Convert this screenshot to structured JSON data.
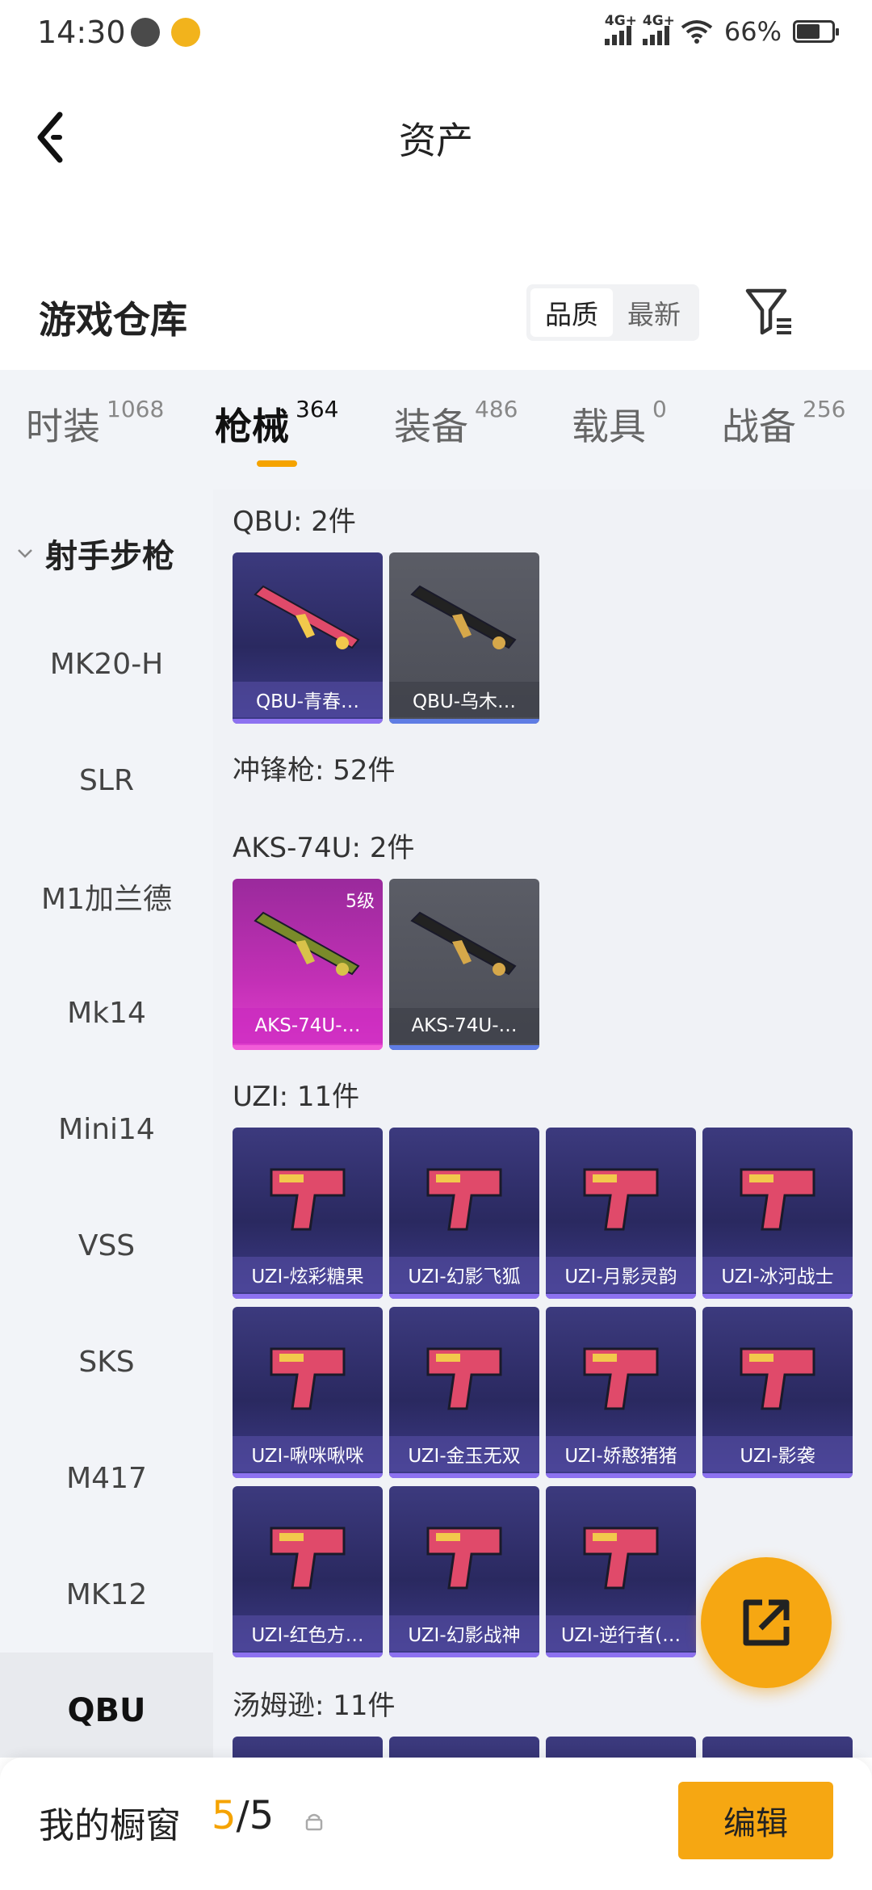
{
  "status_bar": {
    "time": "14:30",
    "network_1": "4G+",
    "network_2": "4G+",
    "battery": "66%",
    "battery_level": 0.66
  },
  "header": {
    "title": "资产",
    "back_icon": "chevron-left-icon"
  },
  "warehouse": {
    "title": "游戏仓库",
    "sort_options": [
      "品质",
      "最新"
    ],
    "sort_selected": "品质",
    "filter_icon": "filter-icon"
  },
  "tabs": [
    {
      "label": "时装",
      "count": "1068"
    },
    {
      "label": "枪械",
      "count": "364",
      "active": true
    },
    {
      "label": "装备",
      "count": "486"
    },
    {
      "label": "载具",
      "count": "0"
    },
    {
      "label": "战备",
      "count": "256"
    }
  ],
  "sidebar": {
    "group_label": "射手步枪",
    "items": [
      "MK20-H",
      "SLR",
      "M1加兰德",
      "Mk14",
      "Mini14",
      "VSS",
      "SKS",
      "M417",
      "MK12",
      "QBU"
    ],
    "active": "QBU"
  },
  "sections": {
    "qbu": "QBU: 2件",
    "smg": "冲锋枪: 52件",
    "aks": "AKS-74U: 2件",
    "uzi": "UZI: 11件",
    "thompson": "汤姆逊: 11件"
  },
  "cards": {
    "qbu": [
      {
        "name": "QBU-青春…",
        "rarity": "purple"
      },
      {
        "name": "QBU-乌木…",
        "rarity": "grey"
      }
    ],
    "aks": [
      {
        "name": "AKS-74U-…",
        "rarity": "pink",
        "level": "5级"
      },
      {
        "name": "AKS-74U-…",
        "rarity": "grey"
      }
    ],
    "uzi": [
      {
        "name": "UZI-炫彩糖果",
        "rarity": "purple"
      },
      {
        "name": "UZI-幻影飞狐",
        "rarity": "purple"
      },
      {
        "name": "UZI-月影灵韵",
        "rarity": "purple"
      },
      {
        "name": "UZI-冰河战士",
        "rarity": "purple"
      },
      {
        "name": "UZI-啾咪啾咪",
        "rarity": "purple"
      },
      {
        "name": "UZI-金玉无双",
        "rarity": "purple"
      },
      {
        "name": "UZI-娇憨猪猪",
        "rarity": "purple"
      },
      {
        "name": "UZI-影袭",
        "rarity": "purple"
      },
      {
        "name": "UZI-红色方…",
        "rarity": "purple"
      },
      {
        "name": "UZI-幻影战神",
        "rarity": "purple"
      },
      {
        "name": "UZI-逆行者(…",
        "rarity": "purple"
      }
    ]
  },
  "showcase": {
    "label": "我的橱窗",
    "used": "5",
    "separator": "/",
    "total": "5",
    "edit_label": "编辑"
  },
  "colors": {
    "accent": "#f6a712",
    "purple_card": "#2a2960",
    "grey_card": "#4b4d56",
    "pink_card": "#c330b6"
  }
}
